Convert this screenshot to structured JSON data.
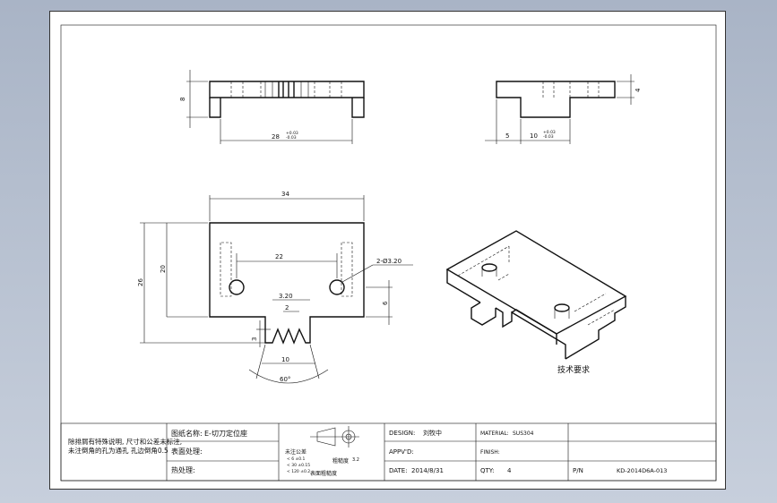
{
  "dimensions": {
    "top_height": "8",
    "top_right_height": "4",
    "length_28": "28",
    "tol_28_upper": "+0.03",
    "tol_28_lower": "-0.03",
    "side_5": "5",
    "side_10": "10",
    "tol_10_upper": "+0.03",
    "tol_10_lower": "-0.03",
    "width_34": "34",
    "height_26": "26",
    "height_20": "20",
    "spacing_22": "22",
    "hole_callout": "2-Ø3.20",
    "slot_320": "3.20",
    "slot_2": "2",
    "dim_6": "6",
    "dim_3": "3",
    "v_width_10": "10",
    "v_angle": "60°"
  },
  "iso_label": "技术要求",
  "title_block": {
    "tech_req": "除排屑有特殊说明, 尺寸和公差未标注, 未注倒角的孔为通孔 孔边倒角0.5",
    "drawing_name_label": "图纸名称:",
    "drawing_name": "E-切刀定位座",
    "surface_label": "表面处理:",
    "heat_label": "热处理:",
    "tol_label": "未注公差",
    "tol_lines": [
      "< 6    ±0.1",
      "< 30   ±0.15",
      "< 120  ±0.2"
    ],
    "roughness_label": "粗糙度",
    "roughness_value": "3.2",
    "surface_mark_label": "表面粗糙度",
    "design_label": "DESIGN:",
    "design_value": "刘牧中",
    "material_label": "MATERIAL:",
    "material_value": "SUS304",
    "approved_label": "APPV'D:",
    "finish_label": "FINISH:",
    "date_label": "DATE:",
    "date_value": "2014/8/31",
    "qty_label": "QTY:",
    "qty_value": "4",
    "pn_label": "P/N",
    "pn_value": "KD-2014D6A-013"
  }
}
